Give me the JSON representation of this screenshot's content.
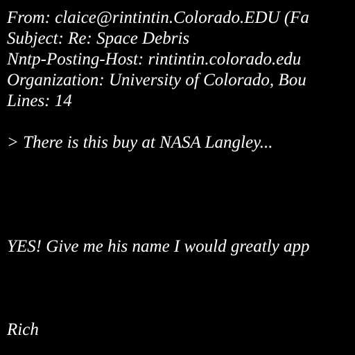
{
  "colors": {
    "background": "#000000",
    "text": "#ffffff"
  },
  "header": {
    "from": "From: claice@rintintin.Colorado.EDU (Fa",
    "subject": "Subject: Re: Space Debris",
    "nntp_posting_host": "Nntp-Posting-Host: rintintin.colorado.edu",
    "organization": "Organization: University of Colorado, Bou",
    "lines": "Lines: 14"
  },
  "body": {
    "quote": "> There is this buy at NASA Langley...",
    "reply": "YES! Give me his name I would greatly app",
    "signature": "Rich"
  }
}
